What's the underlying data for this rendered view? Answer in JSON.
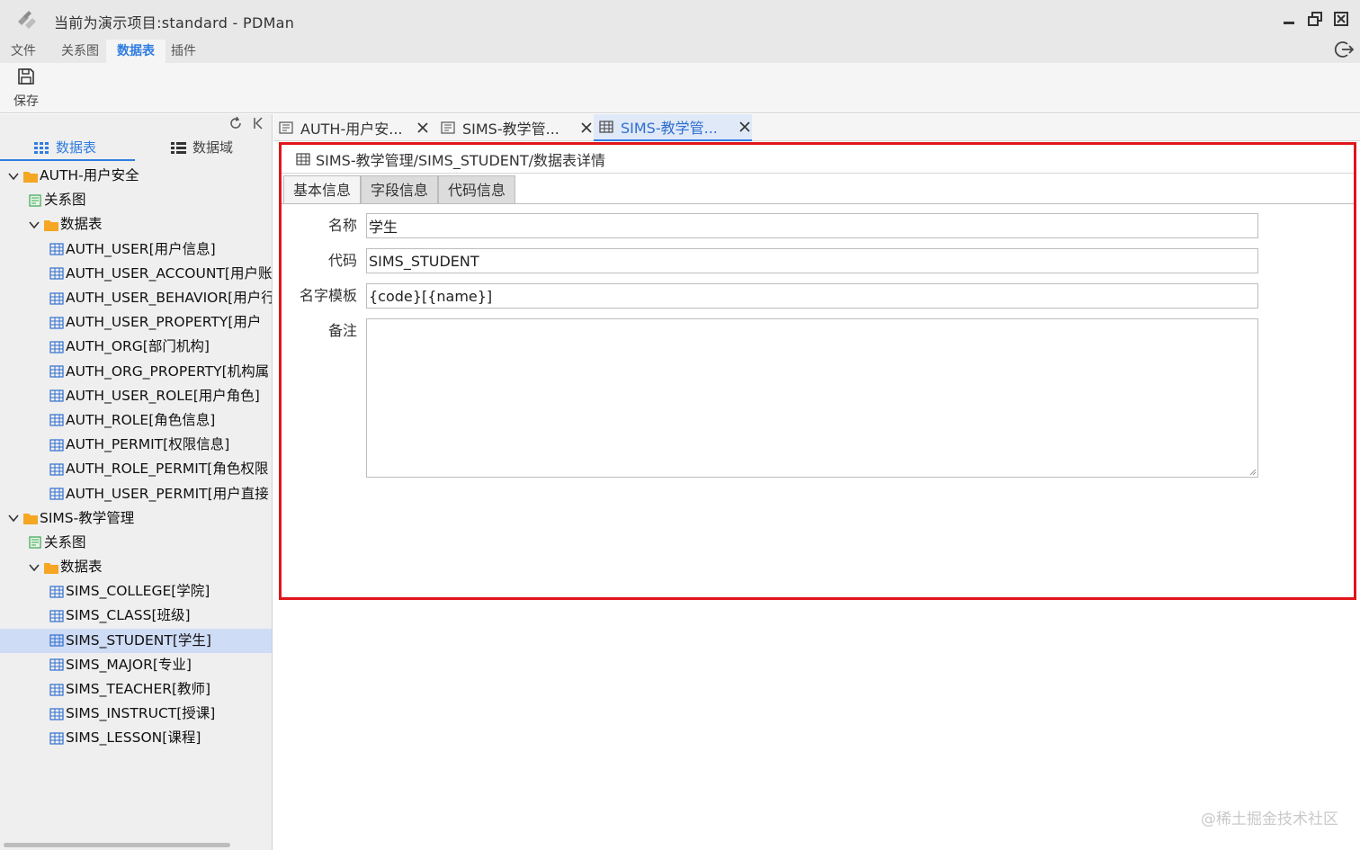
{
  "window": {
    "title": "当前为演示项目:standard - PDMan"
  },
  "menu": [
    "文件",
    "关系图",
    "数据表",
    "插件"
  ],
  "toolbar": {
    "save_label": "保存"
  },
  "sidebar": {
    "tabs": [
      {
        "label": "数据表",
        "icon": "grid-icon"
      },
      {
        "label": "数据域",
        "icon": "list-icon"
      }
    ],
    "tree": [
      {
        "label": "AUTH-用户安全",
        "type": "module"
      },
      {
        "label": "关系图",
        "type": "diagram"
      },
      {
        "label": "数据表",
        "type": "folder"
      },
      {
        "label": "AUTH_USER[用户信息]",
        "type": "table"
      },
      {
        "label": "AUTH_USER_ACCOUNT[用户账",
        "type": "table"
      },
      {
        "label": "AUTH_USER_BEHAVIOR[用户行",
        "type": "table"
      },
      {
        "label": "AUTH_USER_PROPERTY[用户",
        "type": "table"
      },
      {
        "label": "AUTH_ORG[部门机构]",
        "type": "table"
      },
      {
        "label": "AUTH_ORG_PROPERTY[机构属",
        "type": "table"
      },
      {
        "label": "AUTH_USER_ROLE[用户角色]",
        "type": "table"
      },
      {
        "label": "AUTH_ROLE[角色信息]",
        "type": "table"
      },
      {
        "label": "AUTH_PERMIT[权限信息]",
        "type": "table"
      },
      {
        "label": "AUTH_ROLE_PERMIT[角色权限",
        "type": "table"
      },
      {
        "label": "AUTH_USER_PERMIT[用户直接",
        "type": "table"
      },
      {
        "label": "SIMS-教学管理",
        "type": "module"
      },
      {
        "label": "关系图",
        "type": "diagram"
      },
      {
        "label": "数据表",
        "type": "folder"
      },
      {
        "label": "SIMS_COLLEGE[学院]",
        "type": "table"
      },
      {
        "label": "SIMS_CLASS[班级]",
        "type": "table"
      },
      {
        "label": "SIMS_STUDENT[学生]",
        "type": "table",
        "selected": true
      },
      {
        "label": "SIMS_MAJOR[专业]",
        "type": "table"
      },
      {
        "label": "SIMS_TEACHER[教师]",
        "type": "table"
      },
      {
        "label": "SIMS_INSTRUCT[授课]",
        "type": "table"
      },
      {
        "label": "SIMS_LESSON[课程]",
        "type": "table"
      }
    ]
  },
  "doc_tabs": [
    {
      "label": "AUTH-用户安...",
      "icon": "diagram-icon"
    },
    {
      "label": "SIMS-教学管...",
      "icon": "diagram-icon"
    },
    {
      "label": "SIMS-教学管...",
      "icon": "table-icon",
      "active": true
    }
  ],
  "panel": {
    "breadcrumb": "SIMS-教学管理/SIMS_STUDENT/数据表详情",
    "subtabs": [
      "基本信息",
      "字段信息",
      "代码信息"
    ],
    "fields": {
      "name_label": "名称",
      "name_value": "学生",
      "code_label": "代码",
      "code_value": "SIMS_STUDENT",
      "template_label": "名字模板",
      "template_value": "{code}[{name}]",
      "remark_label": "备注",
      "remark_value": ""
    }
  },
  "watermark": "@稀土掘金技术社区",
  "colors": {
    "accent": "#2f7de1",
    "highlight_border": "#e0151b",
    "folder": "#f5a623",
    "table_icon": "#2f6fcf"
  }
}
